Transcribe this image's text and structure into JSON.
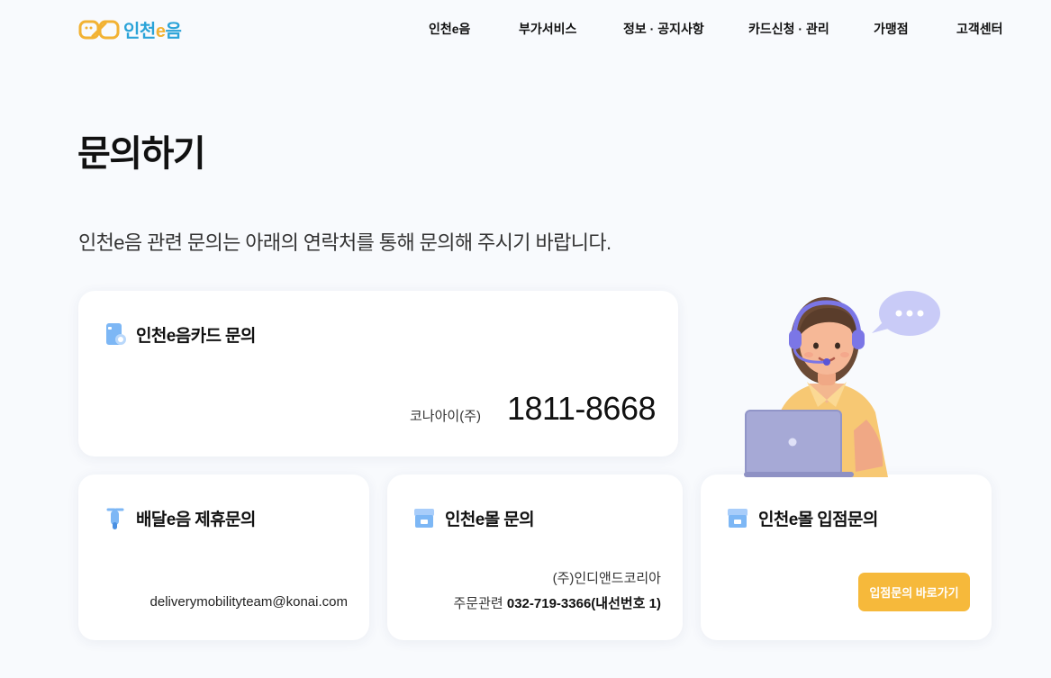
{
  "header": {
    "logo": {
      "brand": "인천",
      "accent": "e",
      "suffix": "음"
    },
    "nav": [
      {
        "label": "인천e음"
      },
      {
        "label": "부가서비스"
      },
      {
        "label": "정보 · 공지사항"
      },
      {
        "label": "카드신청 · 관리"
      },
      {
        "label": "가맹점"
      },
      {
        "label": "고객센터"
      }
    ]
  },
  "page": {
    "title": "문의하기",
    "intro": "인천e음 관련 문의는 아래의 연락처를 통해 문의해 주시기 바랍니다."
  },
  "cards": {
    "card_inquiry": {
      "title": "인천e음카드 문의",
      "company": "코나아이(주)",
      "phone": "1811-8668",
      "icon": "card-icon"
    },
    "delivery": {
      "title": "배달e음 제휴문의",
      "email": "deliverymobilityteam@konai.com",
      "icon": "scooter-icon"
    },
    "mall": {
      "title": "인천e몰 문의",
      "company": "(주)인디앤드코리아",
      "order_label": "주문관련",
      "order_phone": "032-719-3366(내선번호 1)",
      "icon": "shop-icon"
    },
    "mall_entry": {
      "title": "인천e몰 입점문의",
      "button": "입점문의 바로가기",
      "icon": "shop-icon"
    }
  },
  "colors": {
    "accent": "#f6b93b",
    "brand_blue": "#2aa3d8",
    "background": "#f8fafd"
  }
}
